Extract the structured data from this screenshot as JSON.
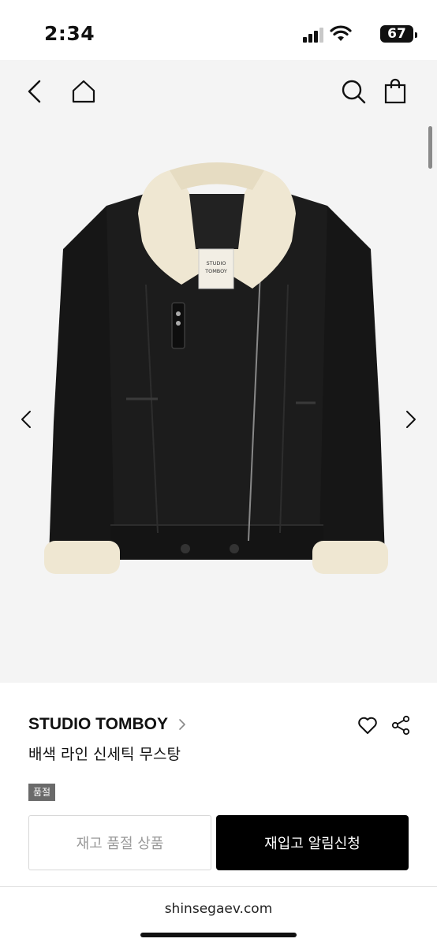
{
  "status_bar": {
    "time": "2:34",
    "battery": "67"
  },
  "gallery": {
    "slide_count": 13,
    "active_index": 0,
    "image_label": "STUDIO TOMBOY"
  },
  "product": {
    "brand": "STUDIO TOMBOY",
    "name": "배색 라인 신세틱 무스탕",
    "badge": "품절",
    "sold_out_label": "재고 품절 상품",
    "restock_label": "재입고 알림신청"
  },
  "browser": {
    "url": "shinsegaev.com"
  },
  "colors": {
    "accent": "#000000",
    "badge_bg": "#6a6a6a",
    "page_bg": "#f4f4f4"
  },
  "icons": {
    "nav": [
      "back-arrow-icon",
      "home-icon",
      "search-icon",
      "shopping-bag-icon"
    ],
    "product": [
      "heart-icon",
      "share-icon"
    ]
  }
}
